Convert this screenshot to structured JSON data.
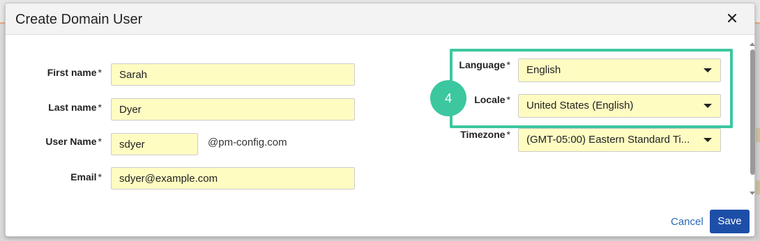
{
  "dialog": {
    "title": "Create Domain User",
    "close_icon": "close-icon"
  },
  "form": {
    "first_name": {
      "label": "First name",
      "required": "*",
      "value": "Sarah"
    },
    "last_name": {
      "label": "Last name",
      "required": "*",
      "value": "Dyer"
    },
    "user_name": {
      "label": "User Name",
      "required": "*",
      "value": "sdyer",
      "suffix": "@pm-config.com"
    },
    "email": {
      "label": "Email",
      "required": "*",
      "value": "sdyer@example.com"
    },
    "language": {
      "label": "Language",
      "required": "*",
      "value": "English"
    },
    "locale": {
      "label": "Locale",
      "required": "*",
      "value": "United States (English)"
    },
    "timezone": {
      "label": "Timezone",
      "required": "*",
      "value": "(GMT-05:00) Eastern Standard Ti..."
    }
  },
  "annotation": {
    "step": "4",
    "color": "#3cc7a0"
  },
  "footer": {
    "cancel_label": "Cancel",
    "save_label": "Save"
  },
  "colors": {
    "field_bg": "#fffcc2",
    "primary": "#1d4fa8",
    "link": "#2a6ab8"
  }
}
